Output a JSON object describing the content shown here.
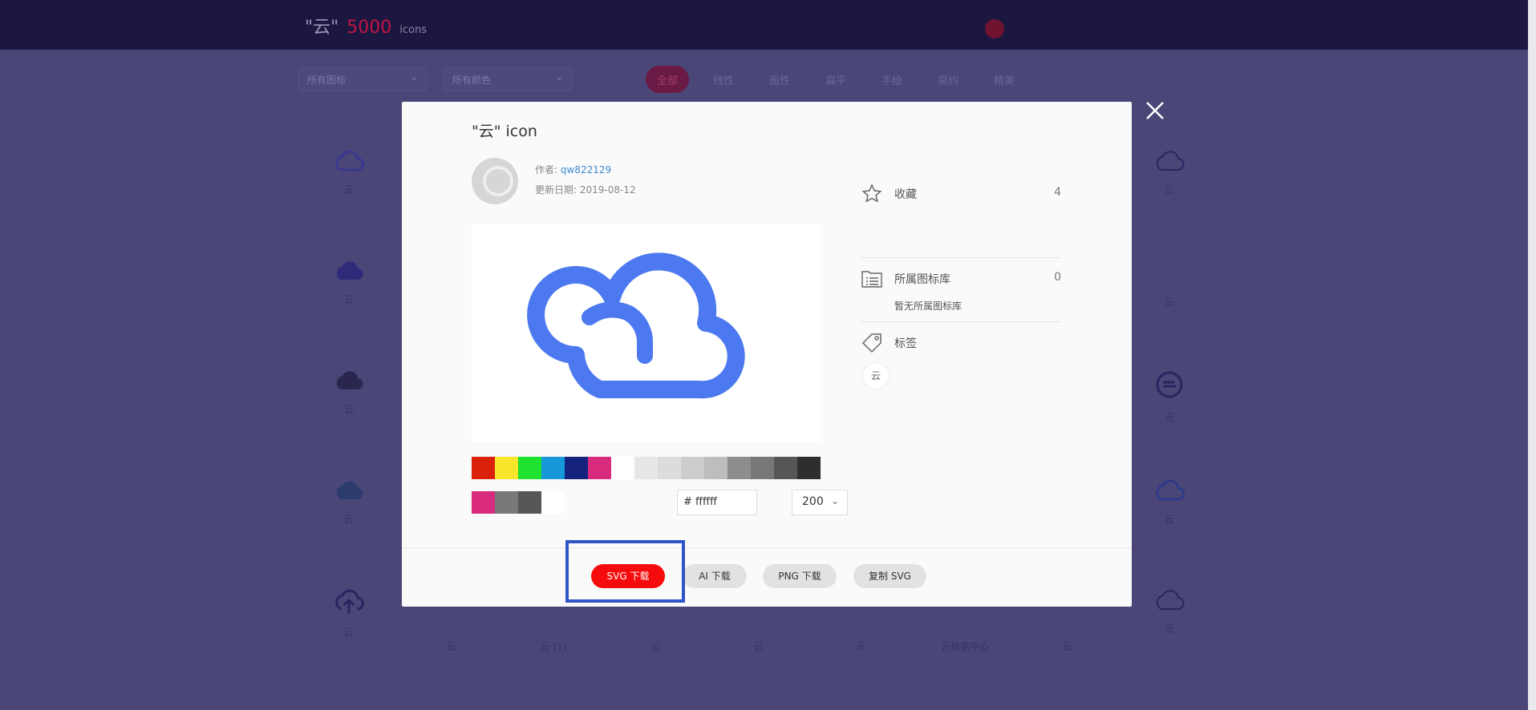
{
  "background": {
    "brand": {
      "quote_title": "\"云\"",
      "count": "5000",
      "suffix": "icons"
    },
    "filters": [
      "所有图标",
      "所有颜色"
    ],
    "tabs": [
      "全部",
      "线性",
      "面性",
      "扁平",
      "手绘",
      "简约",
      "精美"
    ],
    "grid_labels": [
      "云",
      "云",
      "云",
      "云",
      "云",
      "云",
      "云",
      "云",
      "云",
      "云 (1)",
      "云",
      "云",
      "云",
      "云数据中心",
      "云",
      "云"
    ]
  },
  "modal": {
    "title": "\"云\" icon",
    "author_label": "作者:",
    "author_name": "qw822129",
    "updated_label": "更新日期:",
    "updated_date": "2019-08-12",
    "favorites_label": "收藏",
    "favorites_count": "4",
    "library_label": "所属图标库",
    "library_count": "0",
    "no_library_text": "暂无所属图标库",
    "tags_label": "标签",
    "tags": [
      "云"
    ],
    "hex_prefix": "#",
    "hex_value": "ffffff",
    "size_value": "200",
    "palette_colors": [
      "#d9210b",
      "#f6e52b",
      "#1fe130",
      "#1697d7",
      "#16237d",
      "#d82b7e",
      "#ffffff",
      "#e7e7e7",
      "#dcdcdc",
      "#cdcdcd",
      "#bdbdbd",
      "#8d8d8d",
      "#787878",
      "#565656",
      "#2e2e2e"
    ],
    "recent_colors": [
      "#d82b7e",
      "#787878",
      "#565656",
      "#ffffff"
    ],
    "icon_color": "#4c79f0",
    "buttons": {
      "svg": "SVG 下载",
      "ai": "AI 下载",
      "png": "PNG 下载",
      "copy": "复制 SVG"
    }
  },
  "accent_color": "#2f56c7"
}
